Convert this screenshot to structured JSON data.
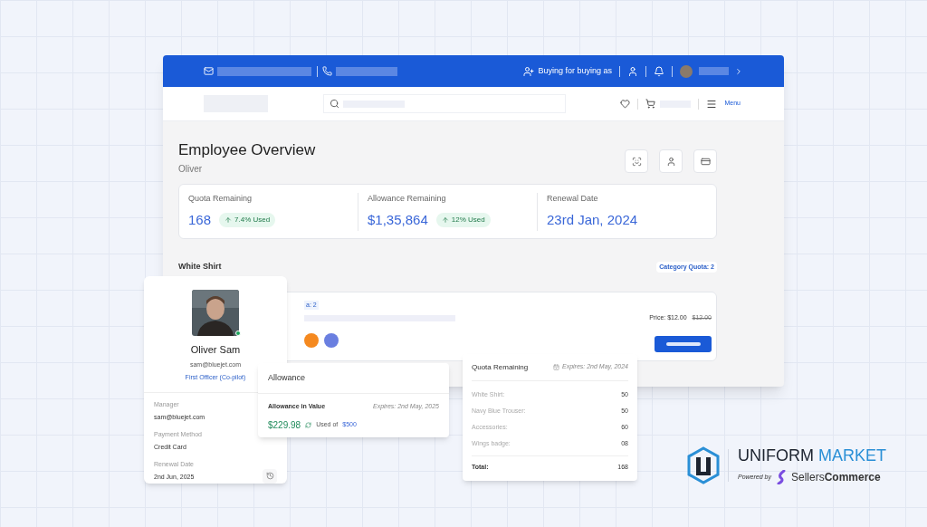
{
  "topbar": {
    "buying_label": "Buying for buying as"
  },
  "nav": {
    "menu": "Menu"
  },
  "header": {
    "title": "Employee Overview",
    "subtitle": "Oliver"
  },
  "stats": [
    {
      "label": "Quota Remaining",
      "value": "168",
      "badge": "7.4% Used"
    },
    {
      "label": "Allowance Remaining",
      "value": "$1,35,864",
      "badge": "12% Used"
    },
    {
      "label": "Renewal Date",
      "value": "23rd Jan, 2024"
    }
  ],
  "section": {
    "title": "White Shirt",
    "category_quota": "Category Quota: 2"
  },
  "product": {
    "quota_fragment": "a: 2",
    "price": "Price: $12.00",
    "old_price": "$12.00",
    "swatches": [
      {
        "color": "#f5891f"
      },
      {
        "color": "#6a7fe0"
      }
    ]
  },
  "profile": {
    "name": "Oliver Sam",
    "email": "sam@bluejet.com",
    "role": "First Officer (Co-pilot)",
    "online": true,
    "fields": [
      {
        "label": "Manager",
        "value": "sam@bluejet.com"
      },
      {
        "label": "Payment Method",
        "value": "Credit Card"
      },
      {
        "label": "Renewal Date",
        "value": "2nd Jun, 2025"
      }
    ]
  },
  "allowance": {
    "title": "Allowance",
    "subtitle": "Allowance in Value",
    "expires": "Expires: 2nd May, 2025",
    "amount": "$229.98",
    "used_of": "Used of",
    "total": "$500"
  },
  "quota": {
    "title": "Quota Remaining",
    "expires": "Expires: 2nd May, 2024",
    "rows": [
      {
        "label": "White Shirt:",
        "value": "50"
      },
      {
        "label": "Navy Blue Trouser:",
        "value": "50"
      },
      {
        "label": "Accessories:",
        "value": "60"
      },
      {
        "label": "Wings badge:",
        "value": "08"
      }
    ],
    "total_label": "Total:",
    "total": "168"
  },
  "brand": {
    "name_dark": "UNIFORM",
    "name_accent": "MARKET",
    "powered_by": "Powered by",
    "partner_a": "Sellers",
    "partner_b": "Commerce"
  }
}
